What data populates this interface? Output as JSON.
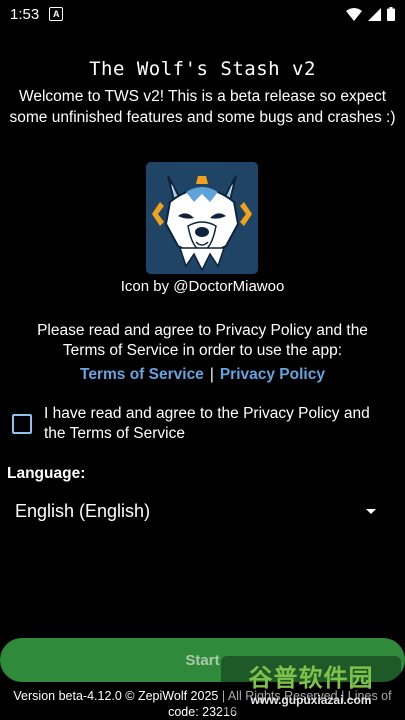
{
  "status_bar": {
    "time": "1:53",
    "notif_letter": "A",
    "icons": [
      "wifi-icon",
      "signal-icon",
      "battery-icon"
    ]
  },
  "title": "The Wolf's Stash v2",
  "welcome": "Welcome to TWS v2! This is a beta release so expect some unfinished features and some bugs and crashes :)",
  "icon_credit": "Icon by @DoctorMiawoo",
  "agreement": {
    "text": "Please read and agree to Privacy Policy and the Terms of Service in order to use the app:",
    "terms_link": "Terms of Service",
    "separator": "|",
    "privacy_link": "Privacy Policy",
    "checkbox_label": "I have read and agree to the Privacy Policy and the Terms of Service",
    "checked": false
  },
  "language": {
    "label": "Language:",
    "selected": "English (English)"
  },
  "start_button": "Start",
  "version": "Version beta-4.12.0 © ZepiWolf 2025 | All Rights Reserved | Lines of code: 23216",
  "watermark": {
    "big": "谷普软件园",
    "small": "www.gupuxiazai.com"
  },
  "colors": {
    "background": "#000000",
    "link": "#64a4df",
    "button": "#2f8a3c",
    "checkbox_border": "#8ec1f2",
    "icon_bg": "#1f4466"
  }
}
